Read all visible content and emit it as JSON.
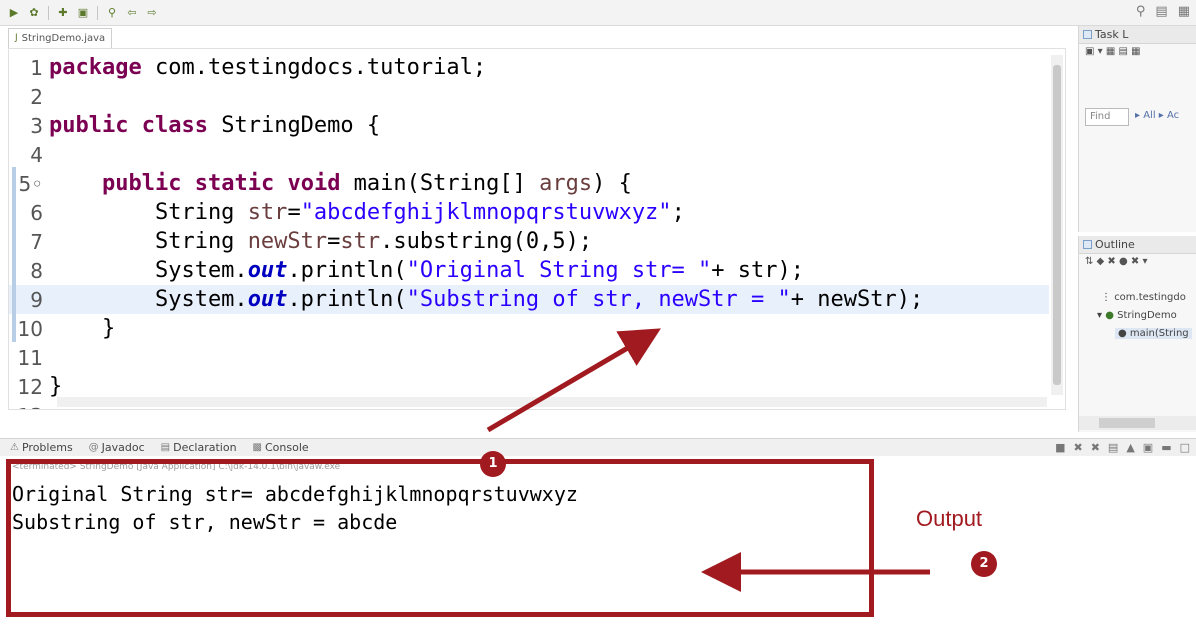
{
  "toolbar": {
    "icons": [
      "run-icon",
      "debug-icon",
      "new-icon",
      "save-icon",
      "search-icon",
      "back-icon",
      "forward-icon"
    ]
  },
  "editor": {
    "tab_label": "StringDemo.java",
    "lines": [
      {
        "n": "1",
        "segments": [
          {
            "t": "package",
            "c": "kw"
          },
          {
            "t": " com.testingdocs.tutorial;",
            "c": "code"
          }
        ]
      },
      {
        "n": "2",
        "segments": []
      },
      {
        "n": "3",
        "segments": [
          {
            "t": "public",
            "c": "kw"
          },
          {
            "t": " ",
            "c": "code"
          },
          {
            "t": "class",
            "c": "kw"
          },
          {
            "t": " StringDemo {",
            "c": "code"
          }
        ]
      },
      {
        "n": "4",
        "segments": []
      },
      {
        "n": "5◦",
        "segments": [
          {
            "t": "    ",
            "c": "code"
          },
          {
            "t": "public",
            "c": "kw"
          },
          {
            "t": " ",
            "c": "code"
          },
          {
            "t": "static",
            "c": "kw"
          },
          {
            "t": " ",
            "c": "code"
          },
          {
            "t": "void",
            "c": "kw"
          },
          {
            "t": " main(String[] ",
            "c": "code"
          },
          {
            "t": "args",
            "c": "var"
          },
          {
            "t": ") {",
            "c": "code"
          }
        ]
      },
      {
        "n": "6",
        "segments": [
          {
            "t": "        String ",
            "c": "code"
          },
          {
            "t": "str",
            "c": "var"
          },
          {
            "t": "=",
            "c": "code"
          },
          {
            "t": "\"abcdefghijklmnopqrstuvwxyz\"",
            "c": "str"
          },
          {
            "t": ";",
            "c": "code"
          }
        ]
      },
      {
        "n": "7",
        "segments": [
          {
            "t": "        String ",
            "c": "code"
          },
          {
            "t": "newStr",
            "c": "var"
          },
          {
            "t": "=",
            "c": "code"
          },
          {
            "t": "str",
            "c": "var"
          },
          {
            "t": ".substring(0,5);",
            "c": "code"
          }
        ]
      },
      {
        "n": "8",
        "segments": [
          {
            "t": "        System.",
            "c": "code"
          },
          {
            "t": "out",
            "c": "fld"
          },
          {
            "t": ".println(",
            "c": "code"
          },
          {
            "t": "\"Original String str= \"",
            "c": "str"
          },
          {
            "t": "+ str);",
            "c": "code"
          }
        ]
      },
      {
        "n": "9",
        "current": true,
        "segments": [
          {
            "t": "        System.",
            "c": "code"
          },
          {
            "t": "out",
            "c": "fld"
          },
          {
            "t": ".println(",
            "c": "code"
          },
          {
            "t": "\"Substring of str, newStr = \"",
            "c": "str"
          },
          {
            "t": "+ newStr);",
            "c": "code"
          }
        ]
      },
      {
        "n": "10",
        "segments": [
          {
            "t": "    }",
            "c": "code"
          }
        ]
      },
      {
        "n": "11",
        "segments": []
      },
      {
        "n": "12",
        "segments": [
          {
            "t": "}",
            "c": "code"
          }
        ]
      },
      {
        "n": "13",
        "segments": []
      }
    ]
  },
  "task_panel": {
    "title": "Task L",
    "find_placeholder": "Find",
    "find_options": "▸ All ▸ Ac"
  },
  "outline_panel": {
    "title": "Outline",
    "items": [
      "com.testingdo",
      "StringDemo",
      "main(String"
    ]
  },
  "bottom_tabs": [
    {
      "label": "Problems",
      "icon": "problems-icon"
    },
    {
      "label": "Javadoc",
      "icon": "javadoc-icon"
    },
    {
      "label": "Declaration",
      "icon": "declaration-icon"
    },
    {
      "label": "Console",
      "icon": "console-icon"
    }
  ],
  "console": {
    "header": "<terminated> StringDemo [Java Application] C:\\jdk-14.0.1\\bin\\javaw.exe",
    "output_lines": [
      "Original String str= abcdefghijklmnopqrstuvwxyz",
      "Substring of str, newStr = abcde"
    ]
  },
  "annotations": {
    "badge_1": "1",
    "badge_2": "2",
    "output_label": "Output",
    "accent_color": "#a11a1f"
  }
}
